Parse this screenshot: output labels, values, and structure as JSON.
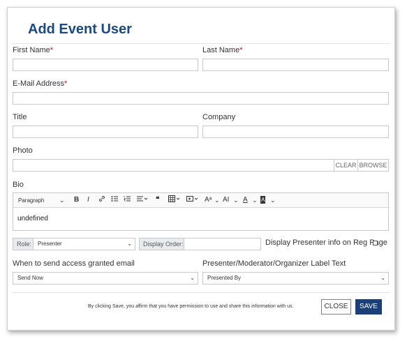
{
  "dialog": {
    "title": "Add Event User",
    "first_name_label": "First Name",
    "last_name_label": "Last Name",
    "email_label": "E-Mail Address",
    "required_mark": "*",
    "title_label": "Title",
    "company_label": "Company",
    "photo_label": "Photo",
    "photo_clear": "CLEAR",
    "photo_browse": "BROWSE",
    "bio_label": "Bio",
    "bio_content": "undefined",
    "toolbar": {
      "paragraph": "Paragraph",
      "bold": "B",
      "italic": "I",
      "link_icon": "link-icon",
      "ul_icon": "bulleted-list-icon",
      "ol_icon": "numbered-list-icon",
      "align_icon": "align-icon",
      "quote": "❝",
      "table_icon": "table-icon",
      "media_icon": "media-icon",
      "font_size": "Aᵃ",
      "text_ai": "AI",
      "font_color": "A",
      "bg_color": "A"
    },
    "role_label": "Role:",
    "role_value": "Presenter",
    "display_order_label": "Display Order:",
    "display_presenter_label": "Display Presenter info on Reg Page",
    "access_email_label": "When to send access granted email",
    "access_email_value": "Send Now",
    "label_text_label": "Presenter/Moderator/Organizer Label Text",
    "label_text_value": "Presented By",
    "footer_note": "By clicking Save, you affirm that you have permission to use and share this information with us.",
    "close_label": "CLOSE",
    "save_label": "SAVE"
  },
  "colors": {
    "title": "#1b4a80",
    "required": "#d0021b",
    "save_bg": "#1b3f78"
  }
}
